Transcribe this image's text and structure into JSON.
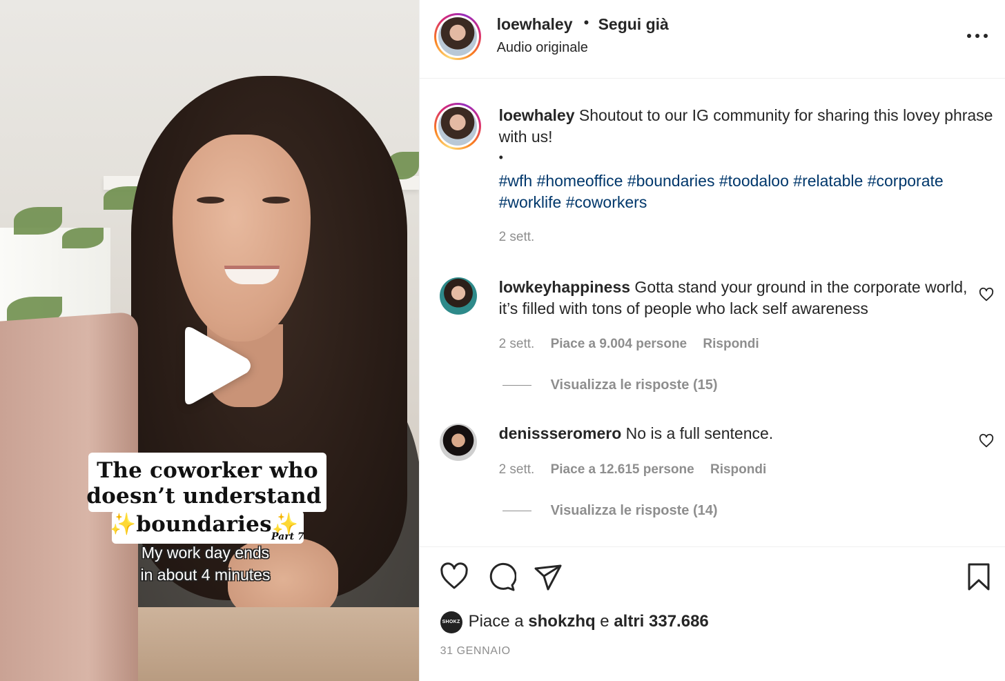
{
  "video": {
    "overlay_title_line1": "The coworker who",
    "overlay_title_line2": "doesn’t understand",
    "overlay_title_line3": "✨boundaries✨",
    "overlay_part": "Part 7",
    "overlay_sub_line1": "My work day ends",
    "overlay_sub_line2": "in about 4  minutes",
    "play_icon": "play-icon"
  },
  "header": {
    "username": "loewhaley",
    "separator": "•",
    "follow_status": "Segui già",
    "audio": "Audio originale",
    "more_icon": "more-options-icon"
  },
  "caption": {
    "username": "loewhaley",
    "text": " Shoutout to our IG community for sharing this lovey phrase with us!",
    "bullet": "•",
    "hashtags": [
      "#wfh",
      "#homeoffice",
      "#boundaries",
      "#toodaloo",
      "#relatable",
      "#corporate",
      "#worklife",
      "#coworkers"
    ],
    "time": "2 sett."
  },
  "comments": [
    {
      "username": "lowkeyhappiness",
      "text": " Gotta stand your ground in the corporate world, it’s filled with tons of people who lack self awareness",
      "time": "2 sett.",
      "likes": "Piace a 9.004 persone",
      "reply": "Rispondi",
      "view_replies": "Visualizza le risposte (15)"
    },
    {
      "username": "denissseromero",
      "text": " No is a full sentence.",
      "time": "2 sett.",
      "likes": "Piace a 12.615 persone",
      "reply": "Rispondi",
      "view_replies": "Visualizza le risposte (14)"
    }
  ],
  "actions": {
    "icons": [
      "heart-icon",
      "comment-icon",
      "share-icon",
      "bookmark-icon"
    ]
  },
  "likes": {
    "avatar_label": "SHOKZ",
    "prefix": "Piace a ",
    "user": "shokzhq",
    "mid": " e ",
    "others": "altri 337.686"
  },
  "date": "31 GENNAIO",
  "colors": {
    "hashtag": "#00376b",
    "muted": "#8e8e8e",
    "text": "#262626"
  }
}
